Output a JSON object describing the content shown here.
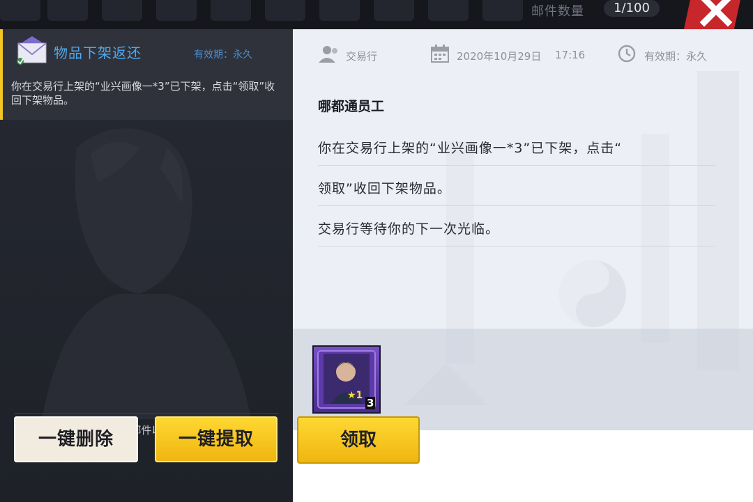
{
  "header": {
    "mail_count_label": "邮件数量",
    "mail_count_value": "1/100",
    "close_icon": "close-x-icon"
  },
  "mail_list": {
    "items": [
      {
        "title": "物品下架返还",
        "validity": "有效期：永久",
        "preview": "你在交易行上架的“业兴画像一*3”已下架，点击“领取”收回下架物品。",
        "icon": "envelope-icon",
        "selected": true
      }
    ],
    "hint": "请及时清理邮件以接收新邮件",
    "delete_all_label": "一键删除",
    "claim_all_label": "一键提取"
  },
  "detail": {
    "source": "交易行",
    "date": "2020年10月29日",
    "time": "17:16",
    "validity": "有效期：永久",
    "sender": "哪都通员工",
    "body_lines": [
      "你在交易行上架的“业兴画像一*3”已下架，点击“",
      "领取”收回下架物品。",
      "交易行等待你的下一次光临。"
    ],
    "attachment": {
      "star_level": "1",
      "quantity": "3"
    },
    "claim_label": "领取"
  },
  "colors": {
    "accent_yellow": "#f3c623",
    "title_blue": "#4fa8ee",
    "close_red": "#c7262b",
    "item_purple": "#6a3fb5"
  }
}
